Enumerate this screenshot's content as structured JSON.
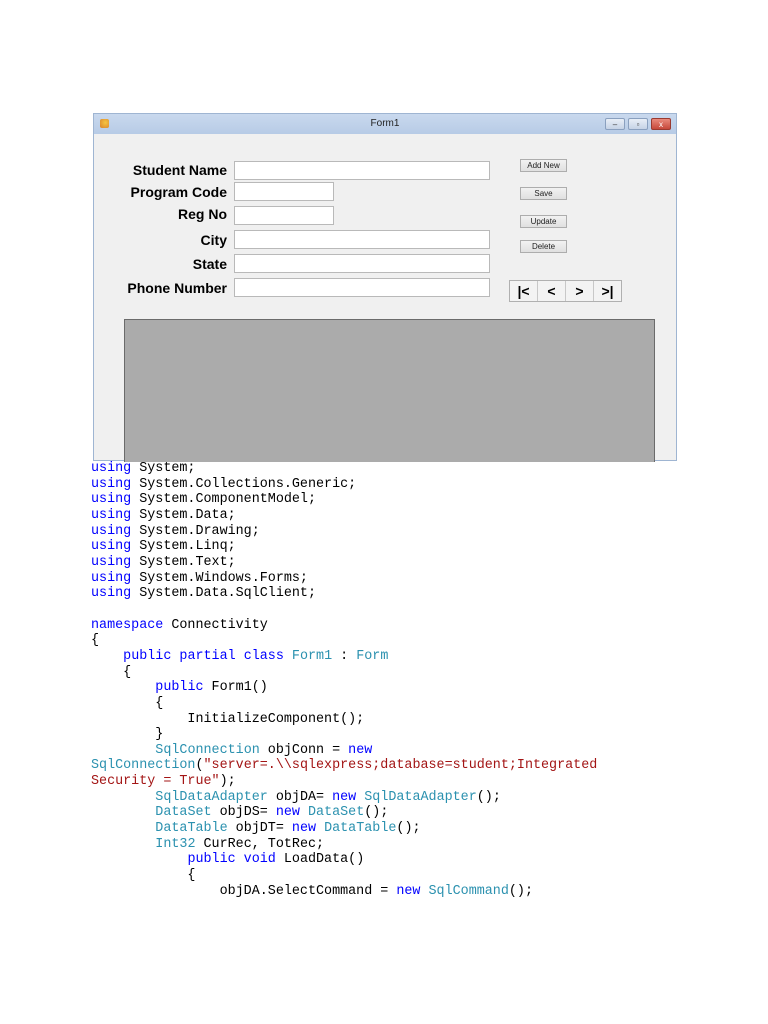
{
  "window": {
    "title": "Form1",
    "controls": {
      "minimize": "–",
      "maximize": "▫",
      "close": "x"
    }
  },
  "form": {
    "fields": [
      {
        "label": "Student Name",
        "value": ""
      },
      {
        "label": "Program Code",
        "value": ""
      },
      {
        "label": "Reg No",
        "value": ""
      },
      {
        "label": "City",
        "value": ""
      },
      {
        "label": "State",
        "value": ""
      },
      {
        "label": "Phone Number",
        "value": ""
      }
    ],
    "buttons": [
      "Add New",
      "Save",
      "Update",
      "Delete"
    ],
    "nav": [
      "|<",
      "<",
      ">",
      ">|"
    ]
  },
  "colors": {
    "keyword": "#0000ff",
    "type": "#2b91af",
    "string": "#a31515"
  },
  "code": [
    [
      [
        "using",
        "kw"
      ],
      [
        " System;",
        ""
      ]
    ],
    [
      [
        "using",
        "kw"
      ],
      [
        " System.Collections.Generic;",
        ""
      ]
    ],
    [
      [
        "using",
        "kw"
      ],
      [
        " System.ComponentModel;",
        ""
      ]
    ],
    [
      [
        "using",
        "kw"
      ],
      [
        " System.Data;",
        ""
      ]
    ],
    [
      [
        "using",
        "kw"
      ],
      [
        " System.Drawing;",
        ""
      ]
    ],
    [
      [
        "using",
        "kw"
      ],
      [
        " System.Linq;",
        ""
      ]
    ],
    [
      [
        "using",
        "kw"
      ],
      [
        " System.Text;",
        ""
      ]
    ],
    [
      [
        "using",
        "kw"
      ],
      [
        " System.Windows.Forms;",
        ""
      ]
    ],
    [
      [
        "using",
        "kw"
      ],
      [
        " System.Data.SqlClient;",
        ""
      ]
    ],
    [],
    [
      [
        "namespace",
        "kw"
      ],
      [
        " Connectivity",
        ""
      ]
    ],
    [
      [
        "{",
        ""
      ]
    ],
    [
      [
        "    ",
        ""
      ],
      [
        "public partial class",
        "kw"
      ],
      [
        " ",
        ""
      ],
      [
        "Form1",
        "ty"
      ],
      [
        " : ",
        ""
      ],
      [
        "Form",
        "ty"
      ]
    ],
    [
      [
        "    {",
        ""
      ]
    ],
    [
      [
        "        ",
        ""
      ],
      [
        "public",
        "kw"
      ],
      [
        " Form1()",
        ""
      ]
    ],
    [
      [
        "        {",
        ""
      ]
    ],
    [
      [
        "            InitializeComponent();",
        ""
      ]
    ],
    [
      [
        "        }",
        ""
      ]
    ],
    [
      [
        "        ",
        ""
      ],
      [
        "SqlConnection",
        "ty"
      ],
      [
        " objConn = ",
        ""
      ],
      [
        "new",
        "kw"
      ]
    ],
    [
      [
        "SqlConnection",
        "ty"
      ],
      [
        "(",
        ""
      ],
      [
        "\"server=.\\\\sqlexpress;database=student;Integrated",
        "st"
      ]
    ],
    [
      [
        "Security = True\"",
        "st"
      ],
      [
        ");",
        ""
      ]
    ],
    [
      [
        "        ",
        ""
      ],
      [
        "SqlDataAdapter",
        "ty"
      ],
      [
        " objDA= ",
        ""
      ],
      [
        "new",
        "kw"
      ],
      [
        " ",
        ""
      ],
      [
        "SqlDataAdapter",
        "ty"
      ],
      [
        "();",
        ""
      ]
    ],
    [
      [
        "        ",
        ""
      ],
      [
        "DataSet",
        "ty"
      ],
      [
        " objDS= ",
        ""
      ],
      [
        "new",
        "kw"
      ],
      [
        " ",
        ""
      ],
      [
        "DataSet",
        "ty"
      ],
      [
        "();",
        ""
      ]
    ],
    [
      [
        "        ",
        ""
      ],
      [
        "DataTable",
        "ty"
      ],
      [
        " objDT= ",
        ""
      ],
      [
        "new",
        "kw"
      ],
      [
        " ",
        ""
      ],
      [
        "DataTable",
        "ty"
      ],
      [
        "();",
        ""
      ]
    ],
    [
      [
        "        ",
        ""
      ],
      [
        "Int32",
        "ty"
      ],
      [
        " CurRec, TotRec;",
        ""
      ]
    ],
    [
      [
        "            ",
        ""
      ],
      [
        "public void",
        "kw"
      ],
      [
        " LoadData()",
        ""
      ]
    ],
    [
      [
        "            {",
        ""
      ]
    ],
    [
      [
        "                objDA.SelectCommand = ",
        ""
      ],
      [
        "new",
        "kw"
      ],
      [
        " ",
        ""
      ],
      [
        "SqlCommand",
        "ty"
      ],
      [
        "();",
        ""
      ]
    ]
  ]
}
